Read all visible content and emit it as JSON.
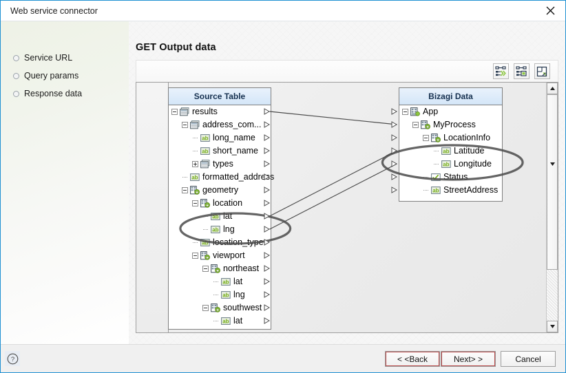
{
  "window": {
    "title": "Web service connector",
    "close_icon": "close-icon"
  },
  "sidebar": {
    "items": [
      {
        "label": "Service URL"
      },
      {
        "label": "Query params"
      },
      {
        "label": "Response data"
      }
    ]
  },
  "main": {
    "page_title": "GET Output data",
    "toolbar": [
      {
        "name": "auto-map-button",
        "icon": "auto-map-icon"
      },
      {
        "name": "map-settings-button",
        "icon": "map-settings-icon"
      },
      {
        "name": "save-mapping-button",
        "icon": "save-mapping-icon"
      }
    ]
  },
  "source_tree": {
    "header": "Source Table",
    "rows": [
      {
        "label": "results",
        "indent": 0,
        "toggle": "minus",
        "icon": "table-icon"
      },
      {
        "label": "address_com...",
        "indent": 1,
        "toggle": "minus",
        "icon": "table-icon"
      },
      {
        "label": "long_name",
        "indent": 2,
        "toggle": "leaf",
        "icon": "text-attr-icon"
      },
      {
        "label": "short_name",
        "indent": 2,
        "toggle": "leaf-last",
        "icon": "text-attr-icon"
      },
      {
        "label": "types",
        "indent": 2,
        "toggle": "plus",
        "icon": "table-icon"
      },
      {
        "label": "formatted_address",
        "indent": 1,
        "toggle": "leaf",
        "icon": "text-attr-icon"
      },
      {
        "label": "geometry",
        "indent": 1,
        "toggle": "minus",
        "icon": "entity-icon"
      },
      {
        "label": "location",
        "indent": 2,
        "toggle": "minus",
        "icon": "entity-icon"
      },
      {
        "label": "lat",
        "indent": 3,
        "toggle": "leaf",
        "icon": "text-attr-icon"
      },
      {
        "label": "lng",
        "indent": 3,
        "toggle": "leaf-last",
        "icon": "text-attr-icon"
      },
      {
        "label": "location_type",
        "indent": 2,
        "toggle": "leaf",
        "icon": "text-attr-icon"
      },
      {
        "label": "viewport",
        "indent": 2,
        "toggle": "minus",
        "icon": "entity-icon"
      },
      {
        "label": "northeast",
        "indent": 3,
        "toggle": "minus",
        "icon": "entity-icon"
      },
      {
        "label": "lat",
        "indent": 4,
        "toggle": "leaf",
        "icon": "text-attr-icon"
      },
      {
        "label": "lng",
        "indent": 4,
        "toggle": "leaf-last",
        "icon": "text-attr-icon"
      },
      {
        "label": "southwest",
        "indent": 3,
        "toggle": "minus",
        "icon": "entity-icon"
      },
      {
        "label": "lat",
        "indent": 4,
        "toggle": "leaf",
        "icon": "text-attr-icon"
      }
    ]
  },
  "target_tree": {
    "header": "Bizagi Data",
    "rows": [
      {
        "label": "App",
        "indent": 0,
        "toggle": "minus",
        "icon": "app-icon"
      },
      {
        "label": "MyProcess",
        "indent": 1,
        "toggle": "minus",
        "icon": "entity-icon"
      },
      {
        "label": "LocationInfo",
        "indent": 2,
        "toggle": "minus",
        "icon": "entity-icon"
      },
      {
        "label": "Latitude",
        "indent": 3,
        "toggle": "leaf",
        "icon": "text-attr-icon"
      },
      {
        "label": "Longitude",
        "indent": 3,
        "toggle": "leaf-last",
        "icon": "text-attr-icon"
      },
      {
        "label": "Status",
        "indent": 2,
        "toggle": "leaf",
        "icon": "boolean-attr-icon"
      },
      {
        "label": "StreetAddress",
        "indent": 2,
        "toggle": "leaf-last",
        "icon": "text-attr-icon"
      }
    ]
  },
  "mappings": [
    {
      "from": "results",
      "to": "MyProcess"
    },
    {
      "from": "lat",
      "to": "Latitude"
    },
    {
      "from": "lng",
      "to": "Longitude"
    }
  ],
  "highlights": [
    {
      "name": "source-latlng-highlight",
      "targets": [
        "lat",
        "lng"
      ]
    },
    {
      "name": "target-latlong-highlight",
      "targets": [
        "Latitude",
        "Longitude"
      ]
    }
  ],
  "scrollbar": {
    "up_arrow": "scroll-up-icon",
    "down_arrow": "scroll-down-icon"
  },
  "footer": {
    "help_icon": "help-icon",
    "buttons": [
      {
        "name": "back-button",
        "label": "< <Back"
      },
      {
        "name": "next-button",
        "label": "Next> >"
      },
      {
        "name": "cancel-button",
        "label": "Cancel"
      }
    ]
  },
  "colors": {
    "accent": "#1e90d2",
    "header_blue": "#d4e6f8",
    "attr_green": "#7ab317",
    "connector": "#4a4a4a"
  }
}
